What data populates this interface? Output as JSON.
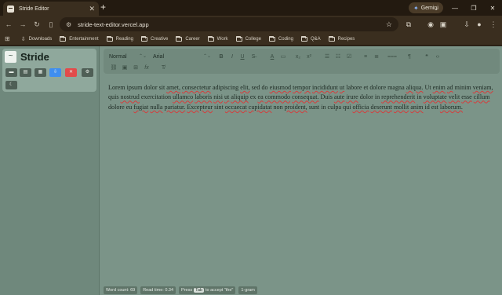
{
  "browser": {
    "tab_title": "Stride Editor",
    "tab_close": "✕",
    "new_tab": "+",
    "gemini_label": "Gemini",
    "url": "stride-text-editor.vercel.app",
    "bookmarks": [
      {
        "label": "Downloads",
        "icon": "download-icon"
      },
      {
        "label": "Entertainment",
        "icon": "folder-icon"
      },
      {
        "label": "Reading",
        "icon": "folder-icon"
      },
      {
        "label": "Creative",
        "icon": "folder-icon"
      },
      {
        "label": "Career",
        "icon": "folder-icon"
      },
      {
        "label": "Work",
        "icon": "folder-icon"
      },
      {
        "label": "College",
        "icon": "folder-icon"
      },
      {
        "label": "Coding",
        "icon": "folder-icon"
      },
      {
        "label": "Q&A",
        "icon": "folder-icon"
      },
      {
        "label": "Recipes",
        "icon": "folder-icon"
      }
    ]
  },
  "app": {
    "brand": "Stride",
    "colors": {
      "accent_blue": "#3f8ef0",
      "danger_red": "#e24b4b",
      "panel": "#8fa89c",
      "background": "#7b9488"
    },
    "sidebar_buttons": [
      "open-folder-icon",
      "new-file-icon",
      "save-file-icon",
      "download-icon",
      "close-icon",
      "settings-icon",
      "dark-mode-moon-icon"
    ],
    "toolbar": {
      "paragraph_style": "Normal",
      "font_family": "Arial"
    },
    "content": "Lorem ipsum dolor sit amet, consectetur adipiscing elit, sed do eiusmod tempor incididunt ut labore et dolore magna aliqua. Ut enim ad minim veniam, quis nostrud exercitation ullamco laboris nisi ut aliquip ex ea commodo consequat. Duis aute irure dolor in reprehenderit in voluptate velit esse cillum dolore eu fugiat nulla pariatur. Excepteur sint occaecat cupidatat non proident, sunt in culpa qui officia deserunt mollit anim id est laborum.",
    "status": {
      "word_count": "Word count: 69",
      "read_time": "Read time: 0.34",
      "press": "Press",
      "key": "Tab",
      "accept": "to accept \"the\"",
      "ngram": "1-gram"
    }
  }
}
